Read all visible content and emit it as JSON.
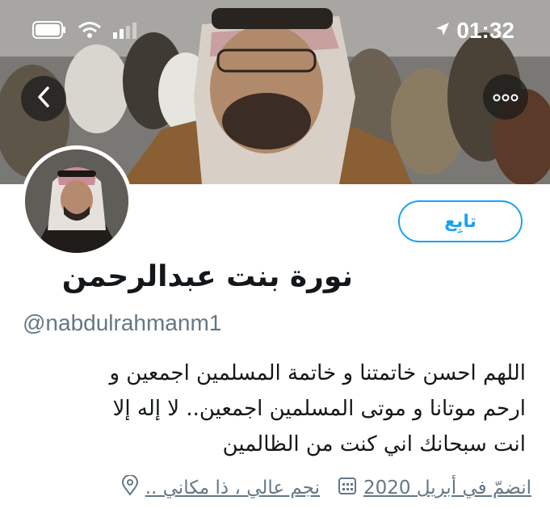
{
  "status_bar": {
    "time": "01:32",
    "location_icon": "location-arrow-icon",
    "battery_icon": "battery-icon",
    "wifi_icon": "wifi-icon",
    "signal_icon": "signal-bars-icon"
  },
  "header": {
    "back_icon": "chevron-left-icon",
    "more_icon": "more-options-icon"
  },
  "profile": {
    "follow_label": "تابِع",
    "display_name": "نورة بنت عبدالرحمن",
    "handle": "@nabdulrahmanm1",
    "bio_lines": [
      "اللهم احسن خاتمتنا و خاتمة المسلمين اجمعين و",
      "ارحم موتانا و موتى المسلمين اجمعين.. لا إله إلا",
      "انت سبحانك اني كنت من الظالمين"
    ],
    "joined": "انضمّ في أبريل 2020",
    "location": "نجم عالي ، ذا مكاني ..",
    "calendar_icon": "calendar-icon",
    "location_icon": "location-pin-icon"
  },
  "colors": {
    "accent": "#1da1f2",
    "text_primary": "#14171a",
    "text_secondary": "#657786"
  }
}
